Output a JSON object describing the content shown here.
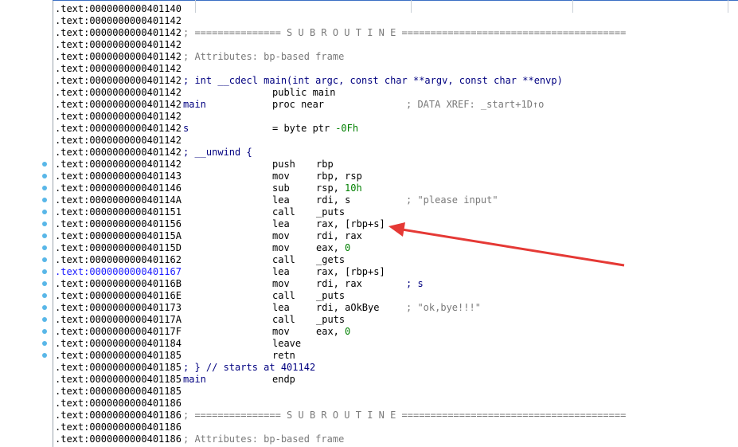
{
  "colors": {
    "address": "#000000",
    "address_highlight": "#1a1aff",
    "comment": "#7a7a7a",
    "code": "#000080",
    "number": "#008000",
    "arrow": "#e53935",
    "marker_dot": "#59b7e8"
  },
  "lines": [
    {
      "addr": ".text:0000000000401140"
    },
    {
      "addr": ".text:0000000000401142"
    },
    {
      "addr": ".text:0000000000401142",
      "comment": "; =============== S U B R O U T I N E ======================================="
    },
    {
      "addr": ".text:0000000000401142"
    },
    {
      "addr": ".text:0000000000401142",
      "comment": "; Attributes: bp-based frame"
    },
    {
      "addr": ".text:0000000000401142"
    },
    {
      "addr": ".text:0000000000401142",
      "decl": "; int __cdecl main(int argc, const char **argv, const char **envp)"
    },
    {
      "addr": ".text:0000000000401142",
      "mnemonic": "public main"
    },
    {
      "addr": ".text:0000000000401142",
      "label": "main",
      "mnemonic": "proc near",
      "xref": "; DATA XREF: _start+1D↑o"
    },
    {
      "addr": ".text:0000000000401142"
    },
    {
      "addr": ".text:0000000000401142",
      "label": "s",
      "mnemonic": "= byte ptr",
      "num": "-0Fh"
    },
    {
      "addr": ".text:0000000000401142"
    },
    {
      "addr": ".text:0000000000401142",
      "decl": "; __unwind {"
    },
    {
      "addr": ".text:0000000000401142",
      "mnemonic": "push",
      "operand": "rbp"
    },
    {
      "addr": ".text:0000000000401143",
      "mnemonic": "mov",
      "operand": "rbp, rsp"
    },
    {
      "addr": ".text:0000000000401146",
      "mnemonic": "sub",
      "operand": "rsp,",
      "num": "10h"
    },
    {
      "addr": ".text:000000000040114A",
      "mnemonic": "lea",
      "operand": "rdi, s",
      "comment": "; \"please input\""
    },
    {
      "addr": ".text:0000000000401151",
      "mnemonic": "call",
      "operand": "_puts"
    },
    {
      "addr": ".text:0000000000401156",
      "mnemonic": "lea",
      "operand": "rax, [rbp+s]"
    },
    {
      "addr": ".text:000000000040115A",
      "mnemonic": "mov",
      "operand": "rdi, rax"
    },
    {
      "addr": ".text:000000000040115D",
      "mnemonic": "mov",
      "operand": "eax,",
      "num": "0"
    },
    {
      "addr": ".text:0000000000401162",
      "mnemonic": "call",
      "operand": "_gets"
    },
    {
      "addr": ".text:0000000000401167",
      "mnemonic": "lea",
      "operand": "rax, [rbp+s]",
      "highlight": true
    },
    {
      "addr": ".text:000000000040116B",
      "mnemonic": "mov",
      "operand": "rdi, rax",
      "decl": "; s"
    },
    {
      "addr": ".text:000000000040116E",
      "mnemonic": "call",
      "operand": "_puts"
    },
    {
      "addr": ".text:0000000000401173",
      "mnemonic": "lea",
      "operand": "rdi, aOkBye",
      "comment": "; \"ok,bye!!!\""
    },
    {
      "addr": ".text:000000000040117A",
      "mnemonic": "call",
      "operand": "_puts"
    },
    {
      "addr": ".text:000000000040117F",
      "mnemonic": "mov",
      "operand": "eax,",
      "num": "0"
    },
    {
      "addr": ".text:0000000000401184",
      "mnemonic": "leave"
    },
    {
      "addr": ".text:0000000000401185",
      "mnemonic": "retn"
    },
    {
      "addr": ".text:0000000000401185",
      "decl": "; } // starts at 401142"
    },
    {
      "addr": ".text:0000000000401185",
      "label": "main",
      "mnemonic": "endp"
    },
    {
      "addr": ".text:0000000000401185"
    },
    {
      "addr": ".text:0000000000401186"
    },
    {
      "addr": ".text:0000000000401186",
      "comment": "; =============== S U B R O U T I N E ======================================="
    },
    {
      "addr": ".text:0000000000401186"
    },
    {
      "addr": ".text:0000000000401186",
      "comment": "; Attributes: bp-based frame"
    }
  ],
  "instruction_markers": {
    "first_line": 13,
    "last_line": 29
  }
}
